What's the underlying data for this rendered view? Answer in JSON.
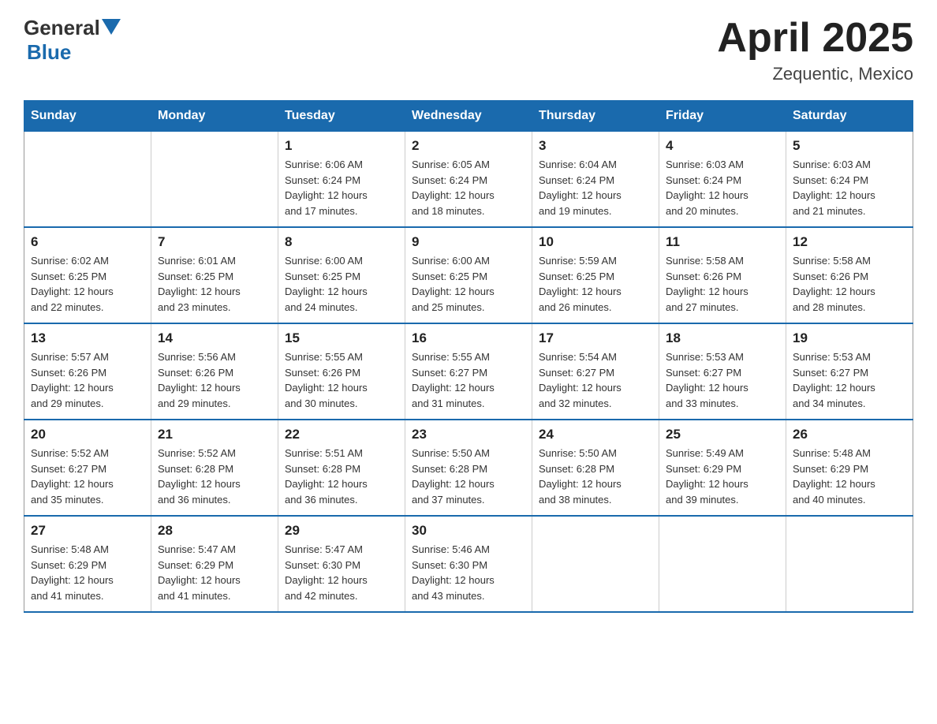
{
  "header": {
    "logo_general": "General",
    "logo_blue": "Blue",
    "month_title": "April 2025",
    "location": "Zequentic, Mexico"
  },
  "weekdays": [
    "Sunday",
    "Monday",
    "Tuesday",
    "Wednesday",
    "Thursday",
    "Friday",
    "Saturday"
  ],
  "weeks": [
    [
      {
        "day": "",
        "info": ""
      },
      {
        "day": "",
        "info": ""
      },
      {
        "day": "1",
        "info": "Sunrise: 6:06 AM\nSunset: 6:24 PM\nDaylight: 12 hours\nand 17 minutes."
      },
      {
        "day": "2",
        "info": "Sunrise: 6:05 AM\nSunset: 6:24 PM\nDaylight: 12 hours\nand 18 minutes."
      },
      {
        "day": "3",
        "info": "Sunrise: 6:04 AM\nSunset: 6:24 PM\nDaylight: 12 hours\nand 19 minutes."
      },
      {
        "day": "4",
        "info": "Sunrise: 6:03 AM\nSunset: 6:24 PM\nDaylight: 12 hours\nand 20 minutes."
      },
      {
        "day": "5",
        "info": "Sunrise: 6:03 AM\nSunset: 6:24 PM\nDaylight: 12 hours\nand 21 minutes."
      }
    ],
    [
      {
        "day": "6",
        "info": "Sunrise: 6:02 AM\nSunset: 6:25 PM\nDaylight: 12 hours\nand 22 minutes."
      },
      {
        "day": "7",
        "info": "Sunrise: 6:01 AM\nSunset: 6:25 PM\nDaylight: 12 hours\nand 23 minutes."
      },
      {
        "day": "8",
        "info": "Sunrise: 6:00 AM\nSunset: 6:25 PM\nDaylight: 12 hours\nand 24 minutes."
      },
      {
        "day": "9",
        "info": "Sunrise: 6:00 AM\nSunset: 6:25 PM\nDaylight: 12 hours\nand 25 minutes."
      },
      {
        "day": "10",
        "info": "Sunrise: 5:59 AM\nSunset: 6:25 PM\nDaylight: 12 hours\nand 26 minutes."
      },
      {
        "day": "11",
        "info": "Sunrise: 5:58 AM\nSunset: 6:26 PM\nDaylight: 12 hours\nand 27 minutes."
      },
      {
        "day": "12",
        "info": "Sunrise: 5:58 AM\nSunset: 6:26 PM\nDaylight: 12 hours\nand 28 minutes."
      }
    ],
    [
      {
        "day": "13",
        "info": "Sunrise: 5:57 AM\nSunset: 6:26 PM\nDaylight: 12 hours\nand 29 minutes."
      },
      {
        "day": "14",
        "info": "Sunrise: 5:56 AM\nSunset: 6:26 PM\nDaylight: 12 hours\nand 29 minutes."
      },
      {
        "day": "15",
        "info": "Sunrise: 5:55 AM\nSunset: 6:26 PM\nDaylight: 12 hours\nand 30 minutes."
      },
      {
        "day": "16",
        "info": "Sunrise: 5:55 AM\nSunset: 6:27 PM\nDaylight: 12 hours\nand 31 minutes."
      },
      {
        "day": "17",
        "info": "Sunrise: 5:54 AM\nSunset: 6:27 PM\nDaylight: 12 hours\nand 32 minutes."
      },
      {
        "day": "18",
        "info": "Sunrise: 5:53 AM\nSunset: 6:27 PM\nDaylight: 12 hours\nand 33 minutes."
      },
      {
        "day": "19",
        "info": "Sunrise: 5:53 AM\nSunset: 6:27 PM\nDaylight: 12 hours\nand 34 minutes."
      }
    ],
    [
      {
        "day": "20",
        "info": "Sunrise: 5:52 AM\nSunset: 6:27 PM\nDaylight: 12 hours\nand 35 minutes."
      },
      {
        "day": "21",
        "info": "Sunrise: 5:52 AM\nSunset: 6:28 PM\nDaylight: 12 hours\nand 36 minutes."
      },
      {
        "day": "22",
        "info": "Sunrise: 5:51 AM\nSunset: 6:28 PM\nDaylight: 12 hours\nand 36 minutes."
      },
      {
        "day": "23",
        "info": "Sunrise: 5:50 AM\nSunset: 6:28 PM\nDaylight: 12 hours\nand 37 minutes."
      },
      {
        "day": "24",
        "info": "Sunrise: 5:50 AM\nSunset: 6:28 PM\nDaylight: 12 hours\nand 38 minutes."
      },
      {
        "day": "25",
        "info": "Sunrise: 5:49 AM\nSunset: 6:29 PM\nDaylight: 12 hours\nand 39 minutes."
      },
      {
        "day": "26",
        "info": "Sunrise: 5:48 AM\nSunset: 6:29 PM\nDaylight: 12 hours\nand 40 minutes."
      }
    ],
    [
      {
        "day": "27",
        "info": "Sunrise: 5:48 AM\nSunset: 6:29 PM\nDaylight: 12 hours\nand 41 minutes."
      },
      {
        "day": "28",
        "info": "Sunrise: 5:47 AM\nSunset: 6:29 PM\nDaylight: 12 hours\nand 41 minutes."
      },
      {
        "day": "29",
        "info": "Sunrise: 5:47 AM\nSunset: 6:30 PM\nDaylight: 12 hours\nand 42 minutes."
      },
      {
        "day": "30",
        "info": "Sunrise: 5:46 AM\nSunset: 6:30 PM\nDaylight: 12 hours\nand 43 minutes."
      },
      {
        "day": "",
        "info": ""
      },
      {
        "day": "",
        "info": ""
      },
      {
        "day": "",
        "info": ""
      }
    ]
  ]
}
